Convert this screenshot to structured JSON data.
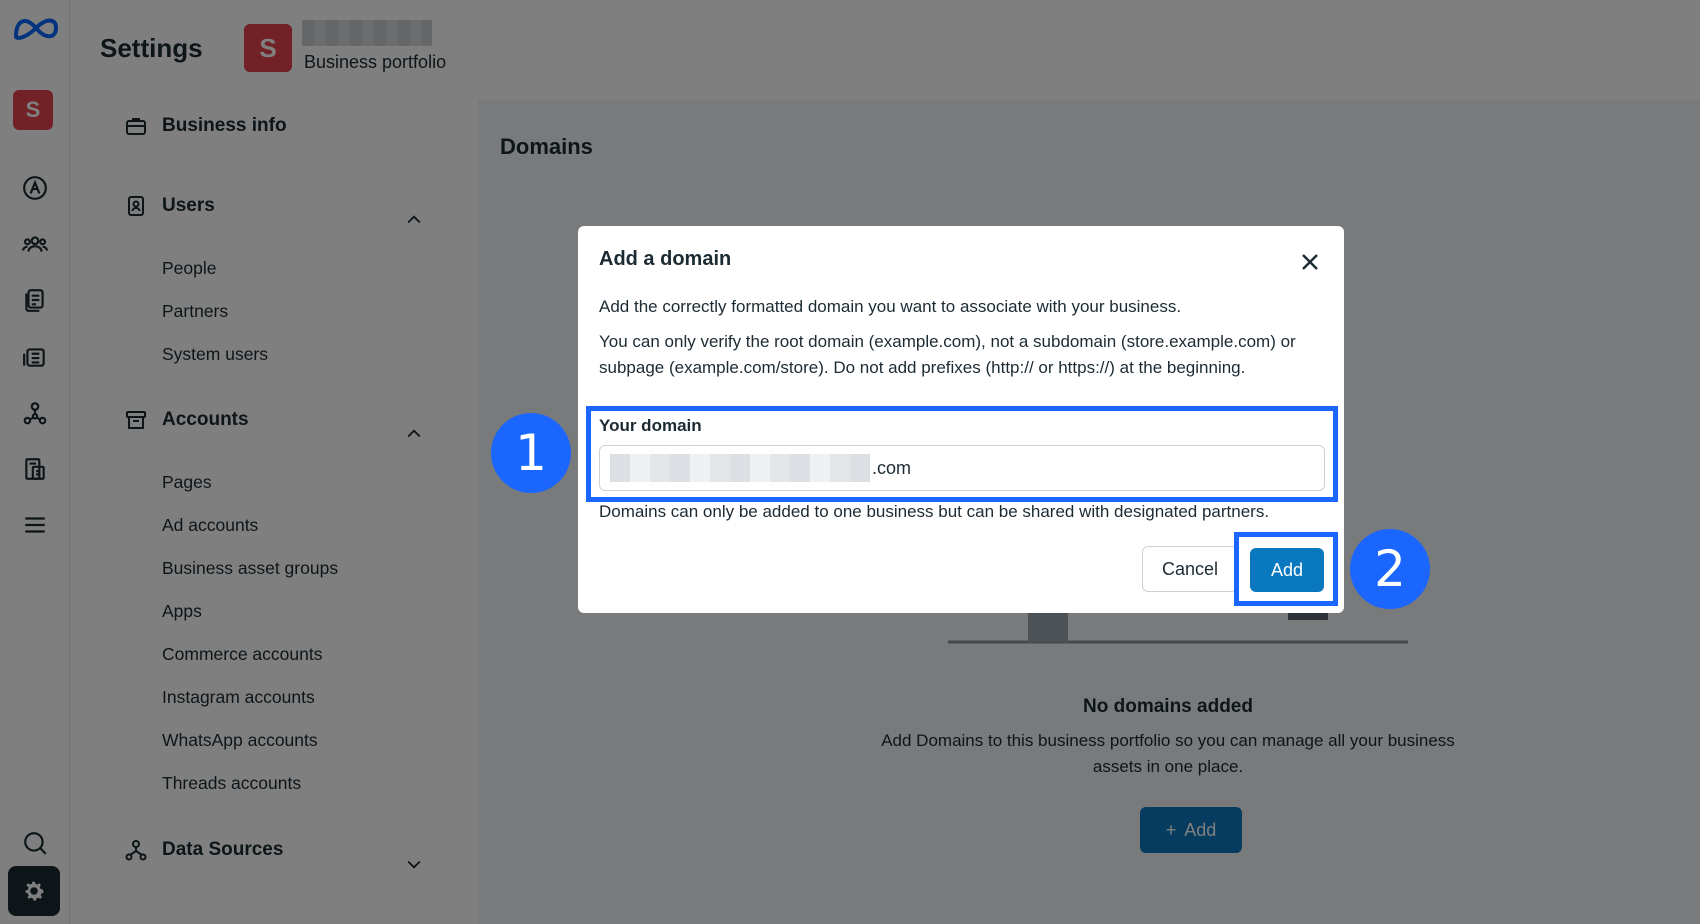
{
  "header": {
    "settings_title": "Settings",
    "portfolio_initial": "S",
    "portfolio_label": "Business portfolio"
  },
  "rail": {
    "avatar_initial": "S",
    "icons": [
      "meta-logo-icon",
      "ads-icon",
      "people-group-icon",
      "pages-icon",
      "catalog-icon",
      "network-icon",
      "billing-icon",
      "menu-icon",
      "search-icon",
      "gear-icon"
    ]
  },
  "sidebar": {
    "business_info": "Business info",
    "users": {
      "label": "Users",
      "items": [
        "People",
        "Partners",
        "System users"
      ]
    },
    "accounts": {
      "label": "Accounts",
      "items": [
        "Pages",
        "Ad accounts",
        "Business asset groups",
        "Apps",
        "Commerce accounts",
        "Instagram accounts",
        "WhatsApp accounts",
        "Threads accounts"
      ]
    },
    "data_sources": "Data Sources"
  },
  "main": {
    "title": "Domains",
    "empty_title": "No domains added",
    "empty_desc": "Add Domains to this business portfolio so you can manage all your business assets in one place.",
    "add_label": "Add"
  },
  "modal": {
    "title": "Add a domain",
    "p1": "Add the correctly formatted domain you want to associate with your business.",
    "p2": "You can only verify the root domain (example.com), not a subdomain (store.example.com) or subpage (example.com/store). Do not add prefixes (http:// or https://) at the beginning.",
    "field_label": "Your domain",
    "domain_suffix": ".com",
    "help": "Domains can only be added to one business but can be shared with designated partners.",
    "cancel": "Cancel",
    "add": "Add"
  },
  "callouts": {
    "one": "1",
    "two": "2",
    "color": "#1a66ff"
  }
}
